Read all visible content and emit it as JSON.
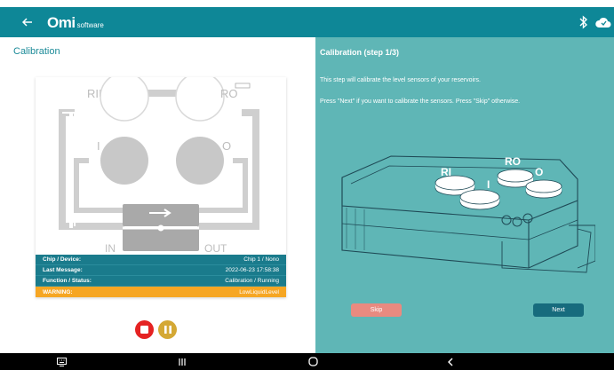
{
  "appbar": {
    "logo_main": "Omi",
    "logo_sub": "software",
    "icons": [
      "back-arrow-icon",
      "bluetooth-icon",
      "cloud-icon"
    ]
  },
  "left": {
    "title": "Calibration",
    "chip": {
      "labels": {
        "ri": "RI",
        "ro": "RO",
        "i": "I",
        "o": "O",
        "in": "IN",
        "out": "OUT"
      }
    },
    "info": [
      {
        "key": "Chip / Device:",
        "value": "Chip 1 / Nono"
      },
      {
        "key": "Last Message:",
        "value": "2022-06-23 17:58:38"
      },
      {
        "key": "Function / Status:",
        "value": "Calibration / Running"
      }
    ],
    "warning": {
      "key": "WARNING:",
      "value": "LowLiquidLevel"
    },
    "controls": [
      "stop-icon",
      "pause-icon"
    ],
    "colors": {
      "stop": "#e52222",
      "pause": "#d4a834",
      "warning": "#f6a623",
      "info": "#1a7b8c"
    }
  },
  "right": {
    "title": "Calibration (step 1/3)",
    "line1": "This step will calibrate the level sensors of your reservoirs.",
    "line2": "Press \"Next\" if you want to calibrate the sensors. Press \"Skip\" otherwise.",
    "device_labels": {
      "ri": "RI",
      "ro": "RO",
      "i": "I",
      "o": "O"
    },
    "skip_label": "Skip",
    "next_label": "Next",
    "colors": {
      "background": "#5fb6b6",
      "skip": "#e98a80",
      "next": "#176b7d"
    }
  },
  "navbar": {
    "icons": [
      "keyboard-icon",
      "recent-apps-icon",
      "home-icon",
      "back-icon"
    ]
  }
}
